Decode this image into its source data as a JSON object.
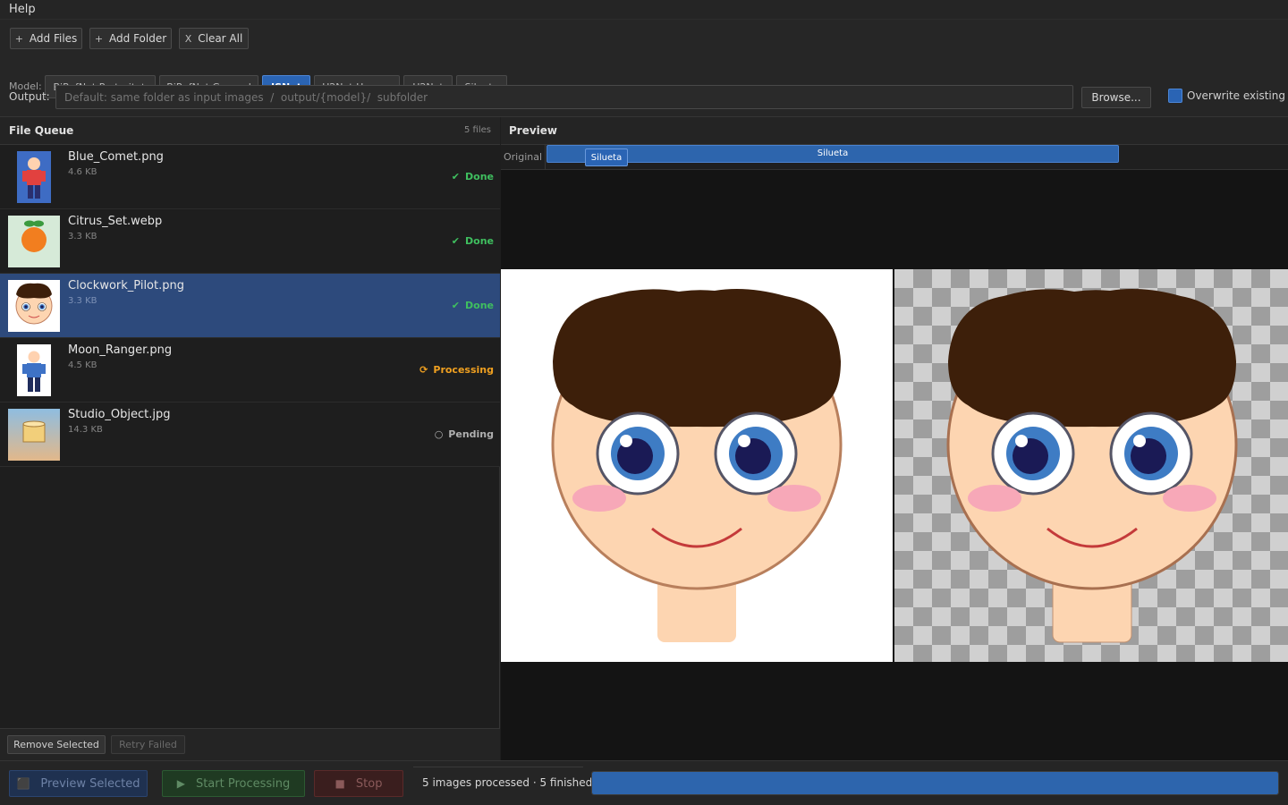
{
  "menu": {
    "help": "Help"
  },
  "toolbar": {
    "add_files": "Add Files",
    "add_folder": "Add Folder",
    "clear_all": "Clear All"
  },
  "model": {
    "label": "Model:",
    "options": [
      "BiRefNet Portrait ★",
      "BiRefNet General",
      "ISNet",
      "U2Net Human",
      "U2Net",
      "Silueta"
    ],
    "selected": "ISNet"
  },
  "output": {
    "label": "Output:",
    "placeholder": "Default: same folder as input images  /  output/{model}/  subfolder",
    "browse": "Browse...",
    "overwrite_label": "Overwrite existing",
    "overwrite_checked": true
  },
  "queue": {
    "title": "File Queue",
    "count": "5 files",
    "files": [
      {
        "name": "Blue_Comet.png",
        "size": "4.6 KB",
        "status": "Done",
        "status_icon": "check-icon",
        "status_color": "#3fbf5f"
      },
      {
        "name": "Citrus_Set.webp",
        "size": "3.3 KB",
        "status": "Done",
        "status_icon": "check-icon",
        "status_color": "#3fbf5f"
      },
      {
        "name": "Clockwork_Pilot.png",
        "size": "3.3 KB",
        "status": "Done",
        "status_icon": "check-icon",
        "status_color": "#3fbf5f",
        "selected": true
      },
      {
        "name": "Moon_Ranger.png",
        "size": "4.5 KB",
        "status": "Processing",
        "status_icon": "refresh-icon",
        "status_color": "#f0a020"
      },
      {
        "name": "Studio_Object.jpg",
        "size": "14.3 KB",
        "status": "Pending",
        "status_icon": "circle-icon",
        "status_color": "#b0b0b0"
      }
    ],
    "remove_selected": "Remove Selected",
    "retry_failed": "Retry Failed"
  },
  "preview": {
    "title": "Preview",
    "original_label": "Original",
    "track_label": "Silueta",
    "tab_label": "Silueta"
  },
  "bottom": {
    "preview_selected": "Preview Selected",
    "start_processing": "Start Processing",
    "stop": "Stop",
    "status_text": "5 images processed · 5 finished",
    "progress_fraction": 1.0
  },
  "colors": {
    "accent": "#2a64b4",
    "done": "#3fbf5f",
    "processing": "#f0a020"
  }
}
